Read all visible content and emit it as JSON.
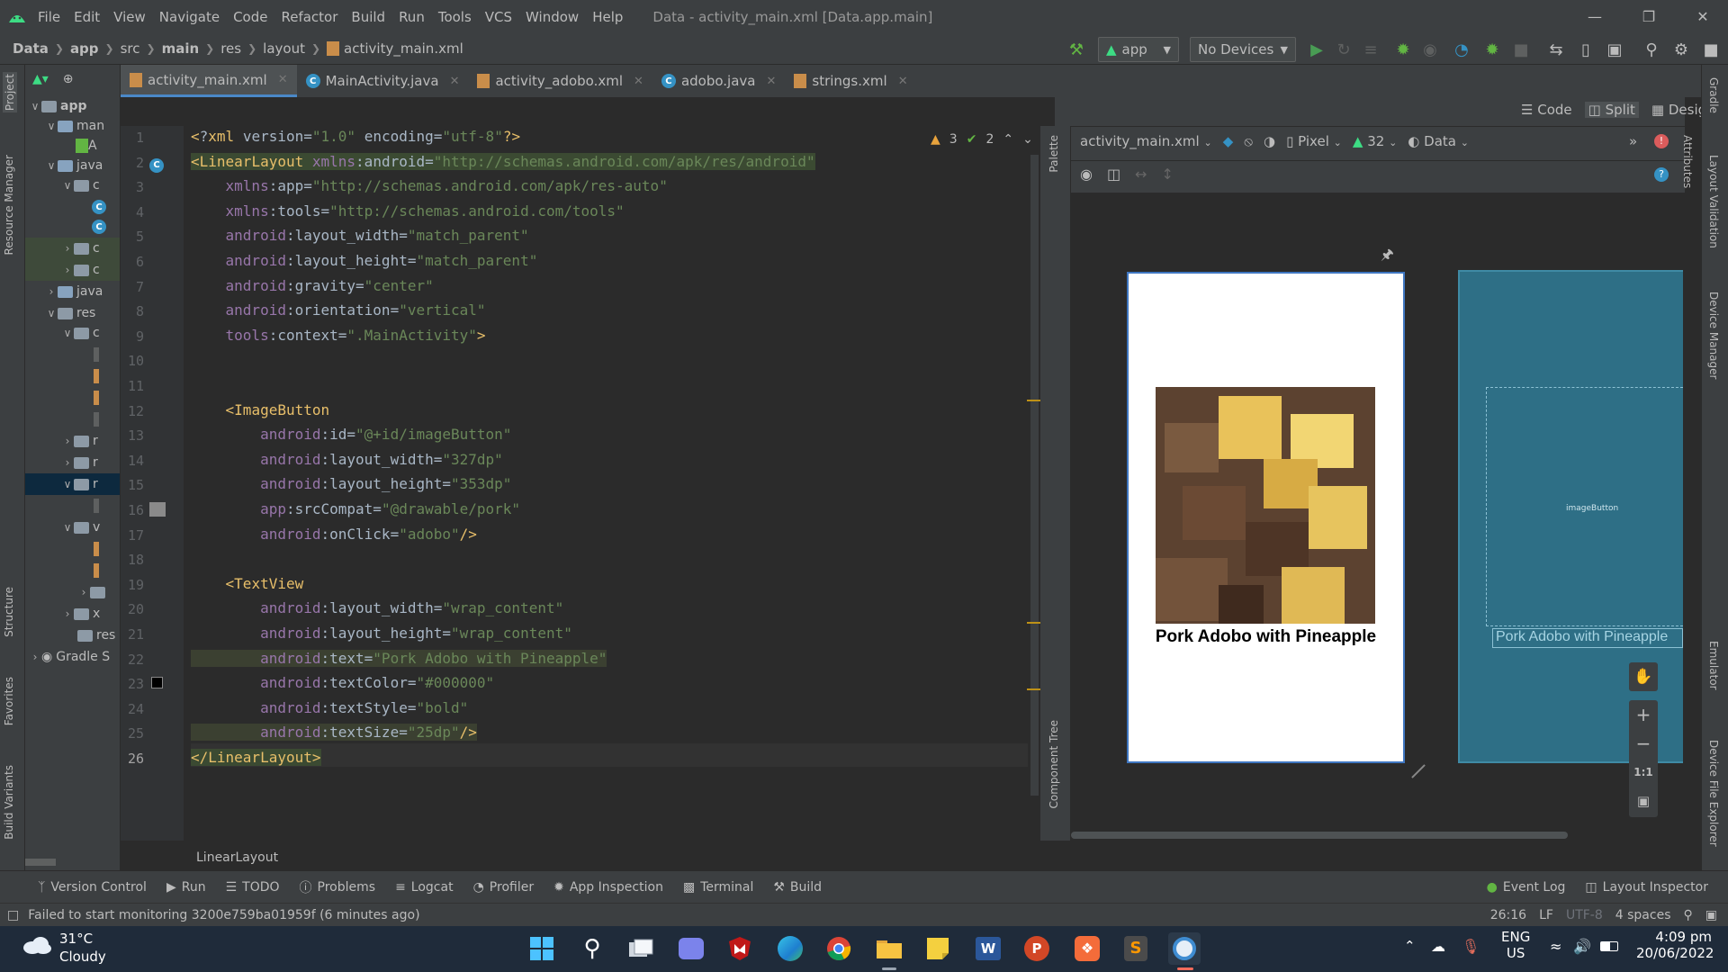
{
  "menu": {
    "items": [
      "File",
      "Edit",
      "View",
      "Navigate",
      "Code",
      "Refactor",
      "Build",
      "Run",
      "Tools",
      "VCS",
      "Window",
      "Help"
    ],
    "window_title": "Data - activity_main.xml [Data.app.main]"
  },
  "breadcrumb": [
    "Data",
    "app",
    "src",
    "main",
    "res",
    "layout",
    "activity_main.xml"
  ],
  "toolbar": {
    "config": "app",
    "devices": "No Devices"
  },
  "tabs": [
    "activity_main.xml",
    "MainActivity.java",
    "activity_adobo.xml",
    "adobo.java",
    "strings.xml"
  ],
  "project_tree": {
    "rows": [
      "app",
      "man",
      "A",
      "java",
      "c",
      "c",
      "c",
      "java",
      "res",
      "c",
      "r",
      "r",
      "r",
      "v",
      "x",
      "res",
      "Gradle S"
    ]
  },
  "left_tools": [
    "Project",
    "Resource Manager",
    "Structure",
    "Favorites",
    "Build Variants"
  ],
  "right_tools": [
    "Gradle",
    "Layout Validation",
    "Device Manager",
    "Emulator",
    "Device File Explorer"
  ],
  "editor": {
    "inspections": {
      "warnings": "3",
      "checks": "2"
    },
    "lines": [
      "<?xml version=\"1.0\" encoding=\"utf-8\"?>",
      "<LinearLayout xmlns:android=\"http://schemas.android.com/apk/res/android\"",
      "    xmlns:app=\"http://schemas.android.com/apk/res-auto\"",
      "    xmlns:tools=\"http://schemas.android.com/tools\"",
      "    android:layout_width=\"match_parent\"",
      "    android:layout_height=\"match_parent\"",
      "    android:gravity=\"center\"",
      "    android:orientation=\"vertical\"",
      "    tools:context=\".MainActivity\">",
      "",
      "",
      "    <ImageButton",
      "        android:id=\"@+id/imageButton\"",
      "        android:layout_width=\"327dp\"",
      "        android:layout_height=\"353dp\"",
      "        app:srcCompat=\"@drawable/pork\"",
      "        android:onClick=\"adobo\"/>",
      "",
      "    <TextView",
      "        android:layout_width=\"wrap_content\"",
      "        android:layout_height=\"wrap_content\"",
      "        android:text=\"Pork Adobo with Pineapple\"",
      "        android:textColor=\"#000000\"",
      "        android:textStyle=\"bold\"",
      "        android:textSize=\"25dp\"/>",
      "</LinearLayout>"
    ],
    "line_numbers": [
      "1",
      "2",
      "3",
      "4",
      "5",
      "6",
      "7",
      "8",
      "9",
      "10",
      "11",
      "12",
      "13",
      "14",
      "15",
      "16",
      "17",
      "18",
      "19",
      "20",
      "21",
      "22",
      "23",
      "24",
      "25",
      "26"
    ],
    "footer_label": "LinearLayout"
  },
  "view_modes": [
    "Code",
    "Split",
    "Design"
  ],
  "designer": {
    "file": "activity_main.xml",
    "device": "Pixel",
    "api": "32",
    "theme": "Data",
    "palette_label": "Palette",
    "tree_label": "Component Tree",
    "attributes_label": "Attributes",
    "preview_text": "Pork Adobo with Pineapple",
    "blueprint_text": "Pork Adobo with Pineapple",
    "blueprint_widget": "imageButton",
    "zoom_fit": "1:1"
  },
  "tool_windows": [
    "Version Control",
    "Run",
    "TODO",
    "Problems",
    "Logcat",
    "Profiler",
    "App Inspection",
    "Terminal",
    "Build"
  ],
  "tool_windows_right": [
    "Event Log",
    "Layout Inspector"
  ],
  "status": {
    "message": "Failed to start monitoring 3200e759ba01959f (6 minutes ago)",
    "position": "26:16",
    "line_sep": "LF",
    "encoding": "UTF-8",
    "indent": "4 spaces"
  },
  "taskbar": {
    "temp": "31°C",
    "weather": "Cloudy",
    "lang": "ENG",
    "region": "US",
    "time": "4:09 pm",
    "date": "20/06/2022"
  },
  "colors": {
    "accent": "#4a88c7",
    "blueprint": "#2e6f86",
    "taskbar": "#1f2b3a"
  }
}
